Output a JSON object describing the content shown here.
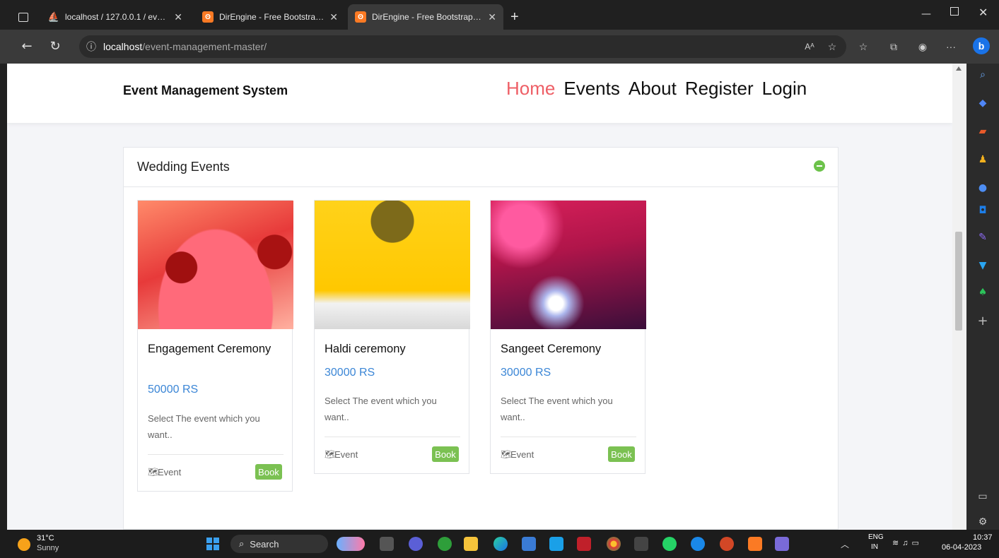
{
  "browser": {
    "tabs": [
      {
        "title": "localhost / 127.0.0.1 / eventmgm",
        "icon": "phpmyadmin-icon"
      },
      {
        "title": "DirEngine - Free Bootstrap 4 Tem",
        "icon": "xampp-icon"
      },
      {
        "title": "DirEngine - Free Bootstrap 4 Tem",
        "icon": "xampp-icon",
        "active": true
      }
    ],
    "new_tab": "+",
    "url_host": "localhost",
    "url_path": "/event-management-master/"
  },
  "site": {
    "brand": "Event Management System",
    "menu": [
      {
        "label": "Home",
        "active": true
      },
      {
        "label": "Events"
      },
      {
        "label": "About"
      },
      {
        "label": "Register"
      },
      {
        "label": "Login"
      }
    ],
    "accent_color": "#ee5f66"
  },
  "panel": {
    "title": "Wedding Events",
    "cards": [
      {
        "title": "Engagement Ceremony",
        "price": "50000 RS",
        "desc": "Select The event which you want..",
        "footer_label": "Event",
        "book_label": "Book"
      },
      {
        "title": "Haldi ceremony",
        "price": "30000 RS",
        "desc": "Select The event which you want..",
        "footer_label": "Event",
        "book_label": "Book"
      },
      {
        "title": "Sangeet Ceremony",
        "price": "30000 RS",
        "desc": "Select The event which you want..",
        "footer_label": "Event",
        "book_label": "Book"
      }
    ]
  },
  "taskbar": {
    "weather_temp": "31°C",
    "weather_desc": "Sunny",
    "search_label": "Search",
    "lang_top": "ENG",
    "lang_bottom": "IN",
    "time": "10:37",
    "date": "06-04-2023"
  }
}
